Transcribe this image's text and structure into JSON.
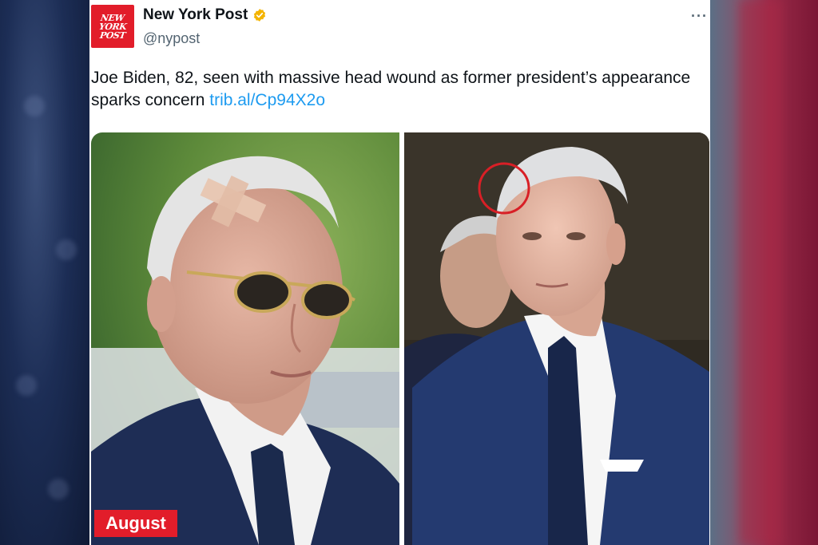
{
  "account": {
    "display_name": "New York Post",
    "handle": "@nypost",
    "avatar_lines": [
      "NEW",
      "YORK",
      "POST"
    ],
    "verified_icon": "verified-badge-icon",
    "verified_color": "#f4b400"
  },
  "menu": {
    "more_label": "···"
  },
  "tweet": {
    "text": "Joe Biden, 82, seen with massive head wound as former president’s appearance sparks concern",
    "link": "trib.al/Cp94X2o"
  },
  "media": {
    "left_photo_badge": "August",
    "badge_color": "#e21d2a",
    "highlight_circle_color": "#d81f26"
  },
  "colors": {
    "link": "#1d9bf0",
    "text": "#0f1419",
    "muted": "#536471"
  }
}
